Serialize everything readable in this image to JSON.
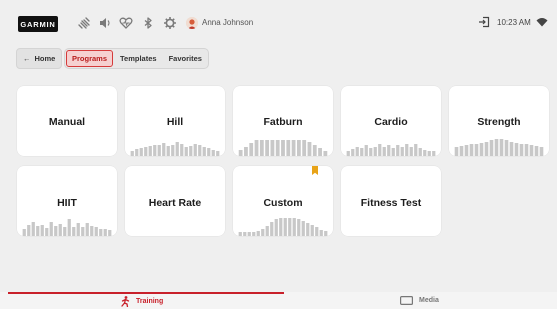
{
  "brand": {
    "logo_text": "GARMIN"
  },
  "status_bar": {
    "user_name": "Anna Johnson",
    "time": "10:23 AM"
  },
  "nav": {
    "home_label": "Home",
    "tabs": [
      {
        "label": "Programs",
        "active": true
      },
      {
        "label": "Templates",
        "active": false
      },
      {
        "label": "Favorites",
        "active": false
      }
    ]
  },
  "programs": [
    {
      "title": "Manual",
      "profile": []
    },
    {
      "title": "Hill",
      "profile": [
        5,
        7,
        8,
        9,
        10,
        11,
        11,
        13,
        10,
        11,
        14,
        12,
        9,
        10,
        12,
        11,
        9,
        8,
        6,
        5
      ]
    },
    {
      "title": "Fatburn",
      "profile": [
        6,
        9,
        13,
        16,
        16,
        16,
        16,
        16,
        16,
        16,
        16,
        16,
        16,
        14,
        11,
        8,
        5
      ]
    },
    {
      "title": "Cardio",
      "profile": [
        5,
        7,
        9,
        8,
        11,
        8,
        9,
        12,
        9,
        11,
        8,
        11,
        9,
        12,
        9,
        12,
        8,
        6,
        5,
        5
      ]
    },
    {
      "title": "Strength",
      "profile": [
        9,
        10,
        11,
        12,
        12,
        13,
        14,
        16,
        17,
        17,
        16,
        14,
        13,
        12,
        12,
        11,
        10,
        9
      ]
    },
    {
      "title": "HIIT",
      "profile": [
        7,
        11,
        14,
        10,
        11,
        8,
        14,
        10,
        12,
        9,
        17,
        9,
        13,
        9,
        13,
        10,
        9,
        7,
        7,
        6
      ]
    },
    {
      "title": "Heart Rate",
      "profile": []
    },
    {
      "title": "Custom",
      "profile": [
        4,
        4,
        4,
        4,
        5,
        7,
        10,
        14,
        17,
        18,
        18,
        18,
        18,
        17,
        15,
        13,
        11,
        9,
        6,
        5
      ],
      "bookmarked": true
    },
    {
      "title": "Fitness Test",
      "profile": []
    }
  ],
  "bottom_nav": {
    "training_label": "Training",
    "media_label": "Media"
  },
  "colors": {
    "accent": "#c8202a",
    "active_tab_bg": "#f6d0d0",
    "bookmark": "#e8a317",
    "profile_bars": "#c8c8c8"
  }
}
